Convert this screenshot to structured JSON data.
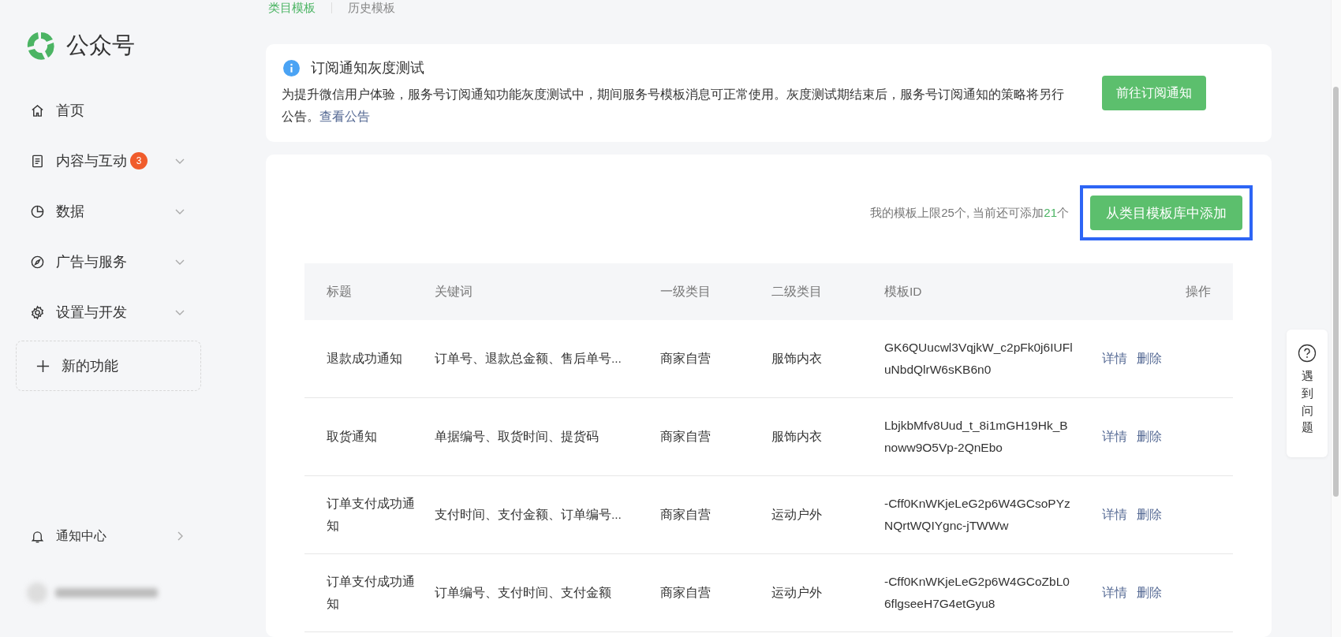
{
  "sidebar": {
    "brand": "公众号",
    "items": [
      {
        "label": "首页",
        "expandable": false
      },
      {
        "label": "内容与互动",
        "badge": "3",
        "expandable": true
      },
      {
        "label": "数据",
        "expandable": true
      },
      {
        "label": "广告与服务",
        "expandable": true
      },
      {
        "label": "设置与开发",
        "expandable": true
      }
    ],
    "new_feature": "新的功能",
    "notifications": "通知中心"
  },
  "tabs": [
    {
      "label": "类目模板",
      "selected": true
    },
    {
      "label": "历史模板",
      "selected": false
    }
  ],
  "notice": {
    "title": "订阅通知灰度测试",
    "body": "为提升微信用户体验，服务号订阅通知功能灰度测试中，期间服务号模板消息可正常使用。灰度测试期结束后，服务号订阅通知的策略将另行公告。",
    "link": "查看公告",
    "button": "前往订阅通知"
  },
  "quota": {
    "before": "我的模板上限25个, 当前还可添加",
    "count": "21",
    "after": "个"
  },
  "add_button": {
    "label": "从类目模板库中添加",
    "highlighted": true
  },
  "table": {
    "columns": [
      "标题",
      "关键词",
      "一级类目",
      "二级类目",
      "模板ID",
      "操作"
    ],
    "rows": [
      {
        "title": "退款成功通知",
        "keywords": "订单号、退款总金额、售后单号...",
        "category_1": "商家自营",
        "category_2": "服饰内衣",
        "template_id": "GK6QUucwl3VqjkW_c2pFk0j6IUFluNbdQlrW6sKB6n0",
        "actions": [
          "详情",
          "删除"
        ]
      },
      {
        "title": "取货通知",
        "keywords": "单据编号、取货时间、提货码",
        "category_1": "商家自营",
        "category_2": "服饰内衣",
        "template_id": "LbjkbMfv8Uud_t_8i1mGH19Hk_Bnoww9O5Vp-2QnEbo",
        "actions": [
          "详情",
          "删除"
        ]
      },
      {
        "title": "订单支付成功通知",
        "keywords": "支付时间、支付金额、订单编号...",
        "category_1": "商家自营",
        "category_2": "运动户外",
        "template_id": "-Cff0KnWKjeLeG2p6W4GCsoPYzNQrtWQIYgnc-jTWWw",
        "actions": [
          "详情",
          "删除"
        ]
      },
      {
        "title": "订单支付成功通知",
        "keywords": "订单编号、支付时间、支付金额",
        "category_1": "商家自营",
        "category_2": "运动户外",
        "template_id": "-Cff0KnWKjeLeG2p6W4GCoZbL06flgseeH7G4etGyu8",
        "actions": [
          "详情",
          "删除"
        ]
      }
    ]
  },
  "help": "遇到问题"
}
